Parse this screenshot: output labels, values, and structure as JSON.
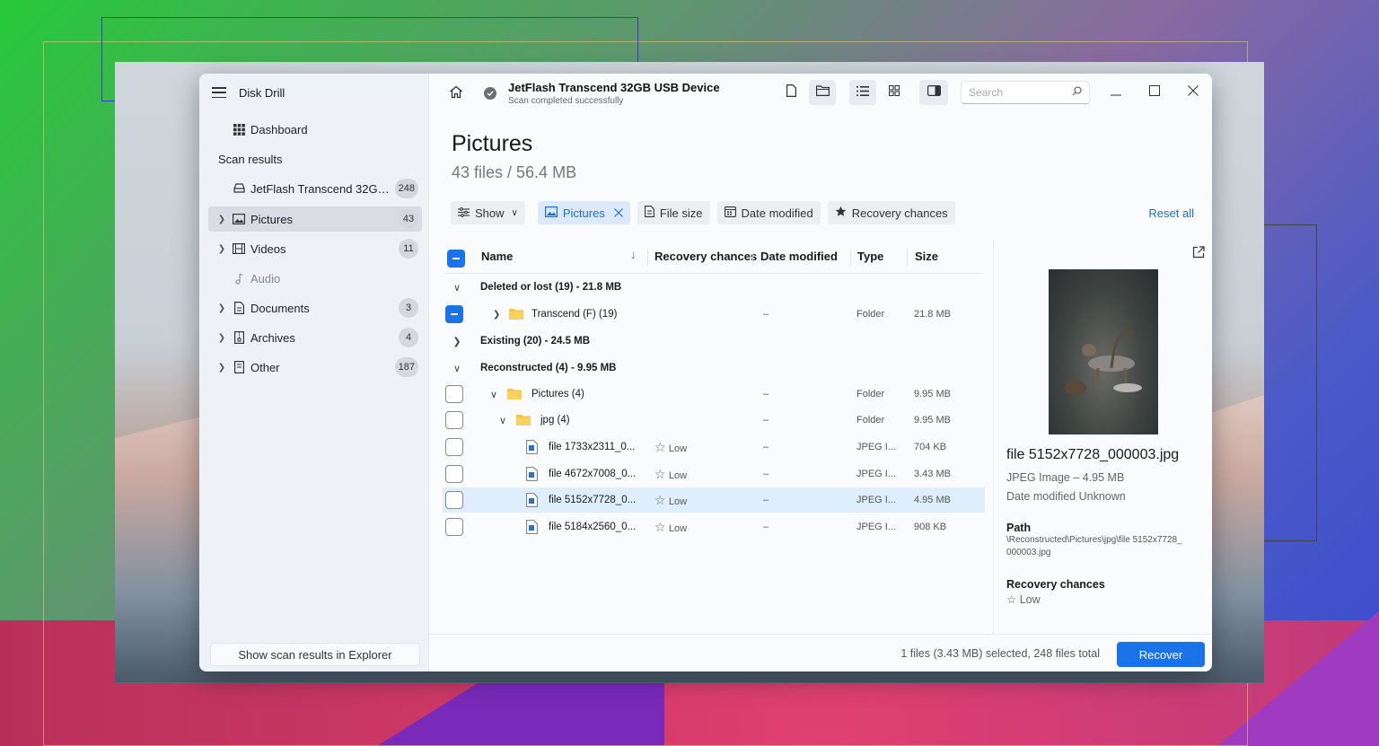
{
  "app": {
    "title": "Disk Drill"
  },
  "sidebar": {
    "dashboard": "Dashboard",
    "section": "Scan results",
    "device": {
      "label": "JetFlash Transcend 32GB U...",
      "count": "248"
    },
    "items": [
      {
        "label": "Pictures",
        "count": "43"
      },
      {
        "label": "Videos",
        "count": "11"
      },
      {
        "label": "Audio",
        "count": ""
      },
      {
        "label": "Documents",
        "count": "3"
      },
      {
        "label": "Archives",
        "count": "4"
      },
      {
        "label": "Other",
        "count": "187"
      }
    ],
    "footer": "Show scan results in Explorer"
  },
  "header": {
    "device_name": "JetFlash Transcend 32GB USB Device",
    "device_status": "Scan completed successfully",
    "search_placeholder": "Search"
  },
  "page": {
    "title": "Pictures",
    "subtitle": "43 files / 56.4 MB"
  },
  "filters": {
    "show": "Show",
    "pictures": "Pictures",
    "file_size": "File size",
    "date_modified": "Date modified",
    "recovery_chances": "Recovery chances",
    "reset": "Reset all"
  },
  "table": {
    "columns": {
      "name": "Name",
      "recovery": "Recovery chances",
      "date": "Date modified",
      "type": "Type",
      "size": "Size"
    },
    "groups": {
      "deleted": "Deleted or lost (19) - 21.8 MB",
      "existing": "Existing (20) - 24.5 MB",
      "reconstructed": "Reconstructed (4) - 9.95 MB"
    },
    "rows": [
      {
        "name": "Transcend (F) (19)",
        "recovery": "",
        "date": "–",
        "type": "Folder",
        "size": "21.8 MB"
      },
      {
        "name": "Pictures (4)",
        "recovery": "",
        "date": "–",
        "type": "Folder",
        "size": "9.95 MB"
      },
      {
        "name": "jpg (4)",
        "recovery": "",
        "date": "–",
        "type": "Folder",
        "size": "9.95 MB"
      },
      {
        "name": "file 1733x2311_0...",
        "recovery": "Low",
        "date": "–",
        "type": "JPEG I...",
        "size": "704 KB"
      },
      {
        "name": "file 4672x7008_0...",
        "recovery": "Low",
        "date": "–",
        "type": "JPEG I...",
        "size": "3.43 MB"
      },
      {
        "name": "file 5152x7728_0...",
        "recovery": "Low",
        "date": "–",
        "type": "JPEG I...",
        "size": "4.95 MB"
      },
      {
        "name": "file 5184x2560_0...",
        "recovery": "Low",
        "date": "–",
        "type": "JPEG I...",
        "size": "908 KB"
      }
    ]
  },
  "preview": {
    "name": "file 5152x7728_000003.jpg",
    "type_size": "JPEG Image – 4.95 MB",
    "date": "Date modified Unknown",
    "path_label": "Path",
    "path": "\\Reconstructed\\Pictures\\jpg\\file 5152x7728_000003.jpg",
    "recovery_label": "Recovery chances",
    "recovery_value": "Low"
  },
  "footer": {
    "status": "1 files (3.43 MB) selected, 248 files total",
    "recover": "Recover"
  },
  "colors": {
    "accent": "#1a73e8",
    "folder": "#f5c542"
  }
}
